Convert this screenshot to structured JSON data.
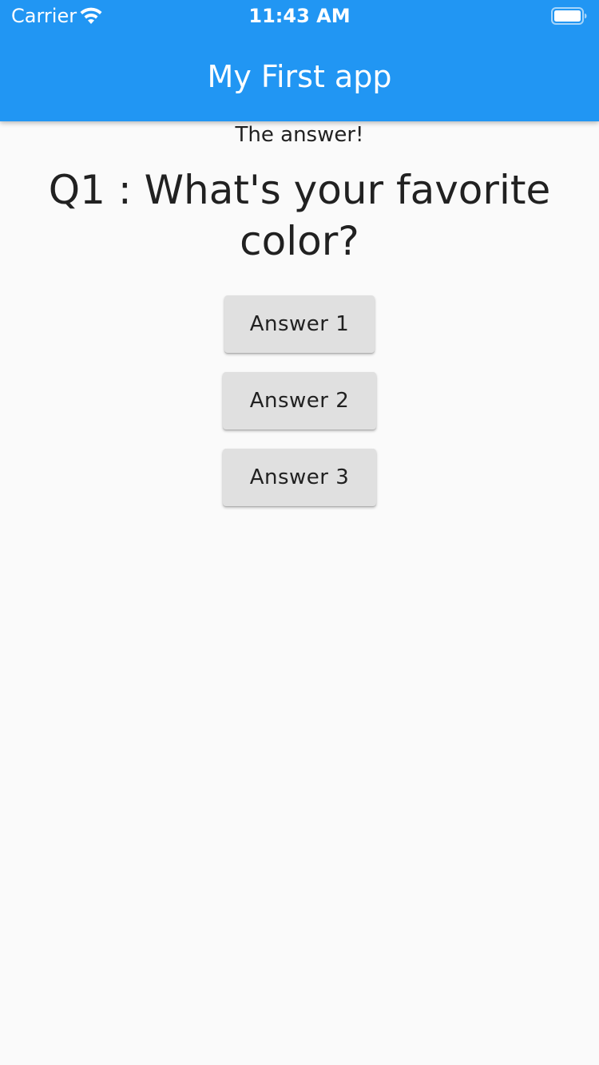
{
  "status_bar": {
    "carrier": "Carrier",
    "time": "11:43 AM",
    "wifi_icon": "wifi-icon",
    "battery_icon": "battery-icon"
  },
  "app_bar": {
    "title": "My First app",
    "color": "#2196f3"
  },
  "body": {
    "answer_text": "The answer!",
    "question": "Q1 : What's your favorite color?",
    "buttons": [
      {
        "label": "Answer 1"
      },
      {
        "label": "Answer 2"
      },
      {
        "label": "Answer 3"
      }
    ]
  }
}
